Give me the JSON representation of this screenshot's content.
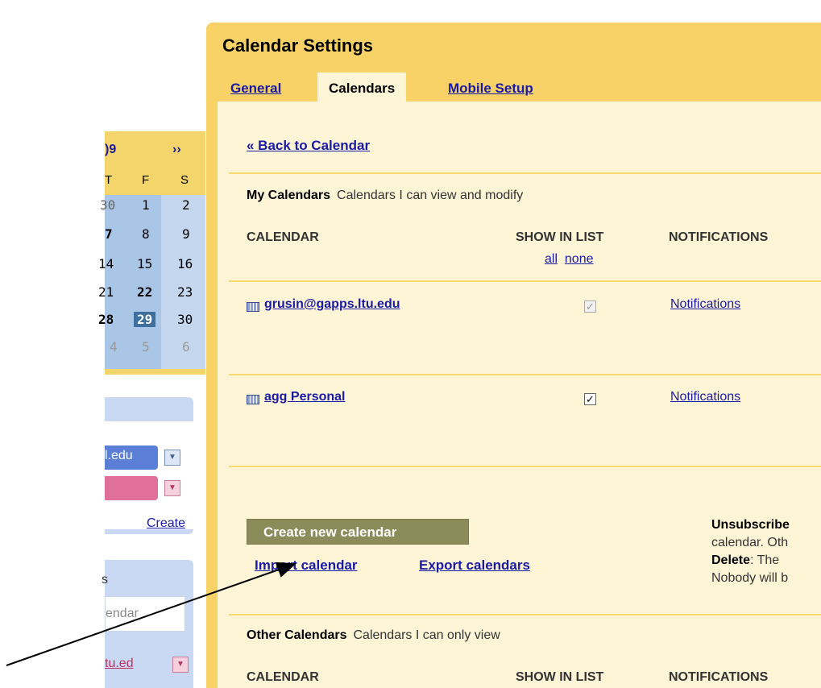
{
  "sidebar": {
    "mini_calendar": {
      "year_fragment": ")9",
      "next": "››",
      "days_of_week": [
        "T",
        "F",
        "S"
      ],
      "rows": [
        [
          "30",
          "1",
          "2"
        ],
        [
          "7",
          "8",
          "9"
        ],
        [
          "14",
          "15",
          "16"
        ],
        [
          "21",
          "22",
          "23"
        ],
        [
          "28",
          "29",
          "30"
        ],
        [
          "4",
          "5",
          "6"
        ]
      ]
    },
    "my_calendars": [
      {
        "label": "l.edu",
        "color": "#5b7fd6"
      },
      {
        "label": "",
        "color": "#e0709a"
      }
    ],
    "create_link": "Create",
    "other_calendars": {
      "header": "s",
      "search_placeholder": "endar",
      "item": "tu.ed"
    }
  },
  "settings": {
    "title": "Calendar Settings",
    "tabs": [
      {
        "label": "General"
      },
      {
        "label": "Calendars"
      },
      {
        "label": "Mobile Setup"
      }
    ],
    "back_link": "« Back to Calendar",
    "my_calendars": {
      "title": "My Calendars",
      "description": "Calendars I can view and modify",
      "columns": {
        "calendar": "CALENDAR",
        "show_in_list": "SHOW IN LIST",
        "notifications": "NOTIFICATIONS"
      },
      "all": "all",
      "none": "none",
      "rows": [
        {
          "name": "grusin@gapps.ltu.edu",
          "checked": true,
          "disabled": true,
          "notifications": "Notifications"
        },
        {
          "name": "agg Personal",
          "checked": true,
          "disabled": false,
          "notifications": "Notifications"
        }
      ]
    },
    "actions": {
      "create_button": "Create new calendar",
      "import_link": "Import calendar",
      "export_link": "Export calendars"
    },
    "help": {
      "unsubscribe_label": "Unsubscribe",
      "unsubscribe_text": "calendar. Oth",
      "delete_label": "Delete",
      "delete_text": ": The",
      "delete_text2": "Nobody will b"
    },
    "other_calendars": {
      "title": "Other Calendars",
      "description": "Calendars I can only view",
      "columns": {
        "calendar": "CALENDAR",
        "show_in_list": "SHOW IN LIST",
        "notifications": "NOTIFICATIONS"
      }
    }
  },
  "colors": {
    "panel_yellow": "#f8d267",
    "content_cream": "#fdf5d6",
    "link_blue": "#1a1aa6",
    "button_olive": "#8c8c5a"
  }
}
